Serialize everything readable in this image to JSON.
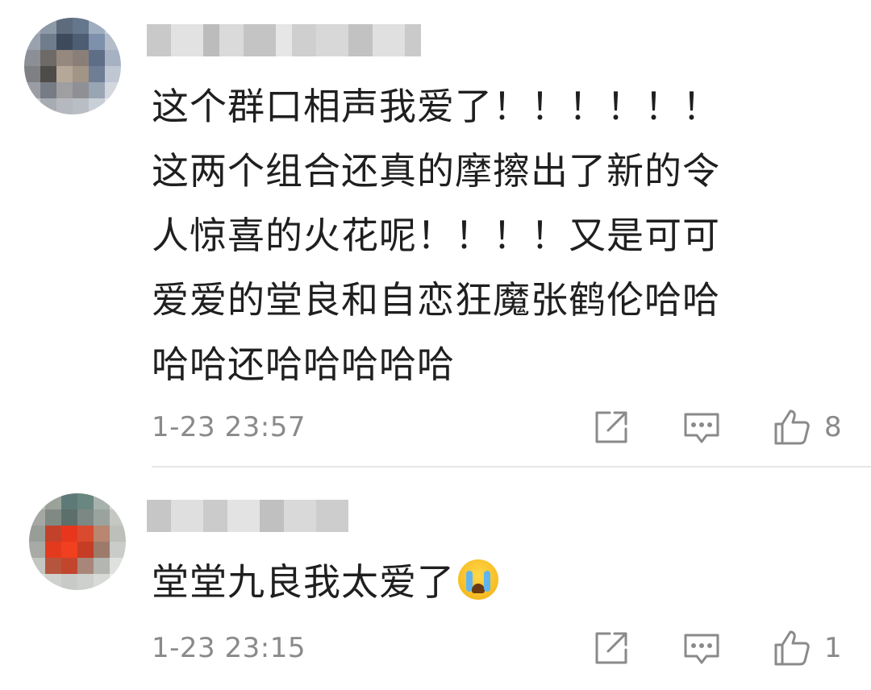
{
  "comments": [
    {
      "text_lines": [
        "这个群口相声我爱了！！！！！！",
        "这两个组合还真的摩擦出了新的令",
        "人惊喜的火花呢！！！！又是可可",
        "爱爱的堂良和自恋狂魔张鹤伦哈哈",
        "哈哈还哈哈哈哈哈"
      ],
      "timestamp": "1-23 23:57",
      "like_count": "8"
    },
    {
      "text": "堂堂九良我太爱了",
      "emoji": "crying-face-emoji",
      "timestamp": "1-23 23:15",
      "like_count": "1"
    }
  ],
  "icons": {
    "share": "share-icon",
    "reply": "reply-icon",
    "like": "thumbs-up-icon"
  },
  "colors": {
    "text": "#1f1f1f",
    "meta": "#8a8a8a",
    "divider": "#e6e6e6",
    "icon": "#8a8a8a"
  }
}
